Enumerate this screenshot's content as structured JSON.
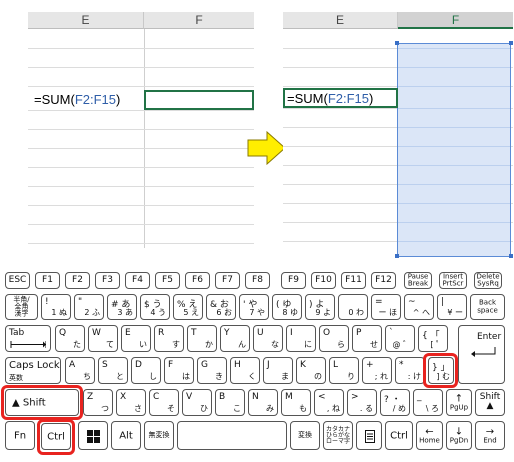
{
  "sheet_before": {
    "col_e": "E",
    "col_f": "F",
    "formula_prefix": "=SUM(",
    "formula_ref": "F2:F15",
    "formula_suffix": ")"
  },
  "sheet_after": {
    "col_e": "E",
    "col_f": "F",
    "formula_prefix": "=SUM(",
    "formula_ref": "F2:F15",
    "formula_suffix": ")"
  },
  "arrow_color": "#ffee00",
  "selection_color": "#dbe6f7",
  "highlight_color": "#e8231f",
  "keyboard": {
    "row1": {
      "esc": "ESC",
      "f1": "F1",
      "f2": "F2",
      "f3": "F3",
      "f4": "F4",
      "f5": "F5",
      "f6": "F6",
      "f7": "F7",
      "f8": "F8",
      "f9": "F9",
      "f10": "F10",
      "f11": "F11",
      "f12": "F12",
      "pause_1": "Pause",
      "pause_2": "Break",
      "insert_1": "Insert",
      "insert_2": "PrtScr",
      "delete_1": "Delete",
      "delete_2": "SysRq"
    },
    "row2": {
      "hankaku_1": "半角/",
      "hankaku_2": "全角",
      "hankaku_3": "漢字",
      "k1": "!",
      "k1b": "1",
      "k1k": "ぬ",
      "k2": "\"",
      "k2b": "2",
      "k2k": "ふ",
      "k3": "#  あ",
      "k3b": "3",
      "k3k": "あ",
      "k4": "$  う",
      "k4b": "4",
      "k4k": "う",
      "k5": "%  え",
      "k5b": "5",
      "k5k": "え",
      "k6": "&  お",
      "k6b": "6",
      "k6k": "お",
      "k7": "'  や",
      "k7b": "7",
      "k7k": "や",
      "k8": "(  ゆ",
      "k8b": "8",
      "k8k": "ゆ",
      "k9": ")  よ",
      "k9b": "9",
      "k9k": "よ",
      "k0": "",
      "k0b": "0",
      "k0k": "わ",
      "kminus": "=",
      "kminusb": "ー",
      "kminusk": "ほ",
      "kcaret": "~",
      "kcaretb": "^",
      "kcaretk": "へ",
      "kyen": "|",
      "kyenb": "¥",
      "kyenk": "ー",
      "back_1": "Back",
      "back_2": "space"
    },
    "row3": {
      "tab": "Tab",
      "q": "Q",
      "qk": "た",
      "w": "W",
      "wk": "て",
      "e": "E",
      "ek": "い",
      "r": "R",
      "rk": "す",
      "t": "T",
      "tk": "か",
      "y": "Y",
      "yk": "ん",
      "u": "U",
      "uk": "な",
      "i": "I",
      "ik": "に",
      "o": "O",
      "ok": "ら",
      "p": "P",
      "pk": "せ",
      "at": "`",
      "atk": "@  ゛",
      "brk": "{  「",
      "brkk": "[  ゜",
      "enter": "Enter"
    },
    "row4": {
      "caps_1": "Caps Lock",
      "caps_2": "英数",
      "a": "A",
      "ak": "ち",
      "s": "S",
      "sk": "と",
      "d": "D",
      "dk": "し",
      "f": "F",
      "fk": "は",
      "g": "G",
      "gk": "き",
      "h": "H",
      "hk": "く",
      "j": "J",
      "jk": "ま",
      "k": "K",
      "kk": "の",
      "l": "L",
      "lk": "り",
      "semi": "+",
      "semik": ";  れ",
      "colon": "*",
      "colonk": ":  け",
      "rbr": "}  」",
      "rbrk": "]  む"
    },
    "row5": {
      "shift": "Shift",
      "z": "Z",
      "zk": "つ",
      "x": "X",
      "xk": "さ",
      "c": "C",
      "ck": "そ",
      "v": "V",
      "vk": "ひ",
      "b": "B",
      "bk": "こ",
      "n": "N",
      "nk": "み",
      "m": "M",
      "mk": "も",
      "comma": "<",
      "commak": ",  ね",
      "period": ">",
      "periodk": ".  る",
      "slash": "?  ・",
      "slashk": "/  め",
      "bslash": "_",
      "bslashk": "\\  ろ",
      "pgup": "PgUp",
      "rshift": "Shift"
    },
    "row6": {
      "fn": "Fn",
      "ctrl": "Ctrl",
      "alt": "Alt",
      "muhenkan": "無変換",
      "henkan": "変換",
      "kana_1": "カタカナ",
      "kana_2": "ひらがな",
      "kana_3": "ローマ字",
      "rctrl": "Ctrl",
      "home": "Home",
      "pgdn": "PgDn",
      "end": "End"
    }
  }
}
